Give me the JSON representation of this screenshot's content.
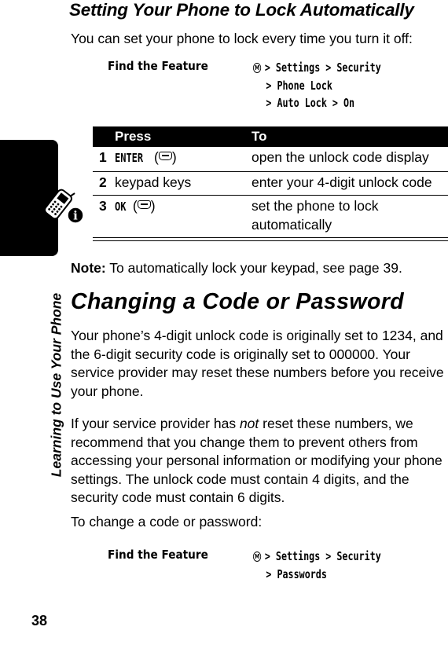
{
  "page": {
    "number": "38",
    "side_tab_label": "Learning to Use Your Phone",
    "side_icon": "phone-info-icon"
  },
  "section1": {
    "heading": "Setting Your Phone to Lock Automatically",
    "intro": "You can set your phone to lock every time you turn it off:",
    "find_feature": {
      "label": "Find the Feature",
      "menu_icon": "menu-key-icon",
      "path_lines": [
        "> Settings > Security",
        "> Phone Lock",
        "> Auto Lock > On"
      ]
    },
    "table": {
      "headers": {
        "num": "",
        "press": "Press",
        "to": "To"
      },
      "rows": [
        {
          "num": "1",
          "press": "ENTER",
          "press_key_icon": "center-select-key-icon",
          "to": "open the unlock code display"
        },
        {
          "num": "2",
          "press": "keypad keys",
          "to": "enter your 4-digit unlock code"
        },
        {
          "num": "3",
          "press": "OK",
          "press_key_icon": "center-select-key-icon",
          "to": "set the phone to lock automatically"
        }
      ]
    },
    "note": {
      "label": "Note:",
      "text": "To automatically lock your keypad, see page 39."
    }
  },
  "section2": {
    "heading": "Changing a Code or Password",
    "paragraph1": "Your phone’s 4-digit unlock code is originally set to 1234, and the 6-digit security code is originally set to 000000. Your service provider may reset these numbers before you receive your phone.",
    "paragraph2_pre": "If your service provider has ",
    "paragraph2_em": "not",
    "paragraph2_post": " reset these numbers, we recommend that you change them to prevent others from accessing your personal information or modifying your phone settings. The unlock code must contain 4 digits, and the security code must contain 6 digits.",
    "paragraph3": "To change a code or password:",
    "find_feature": {
      "label": "Find the Feature",
      "menu_icon": "menu-key-icon",
      "path_lines": [
        "> Settings > Security",
        "> Passwords"
      ]
    }
  }
}
